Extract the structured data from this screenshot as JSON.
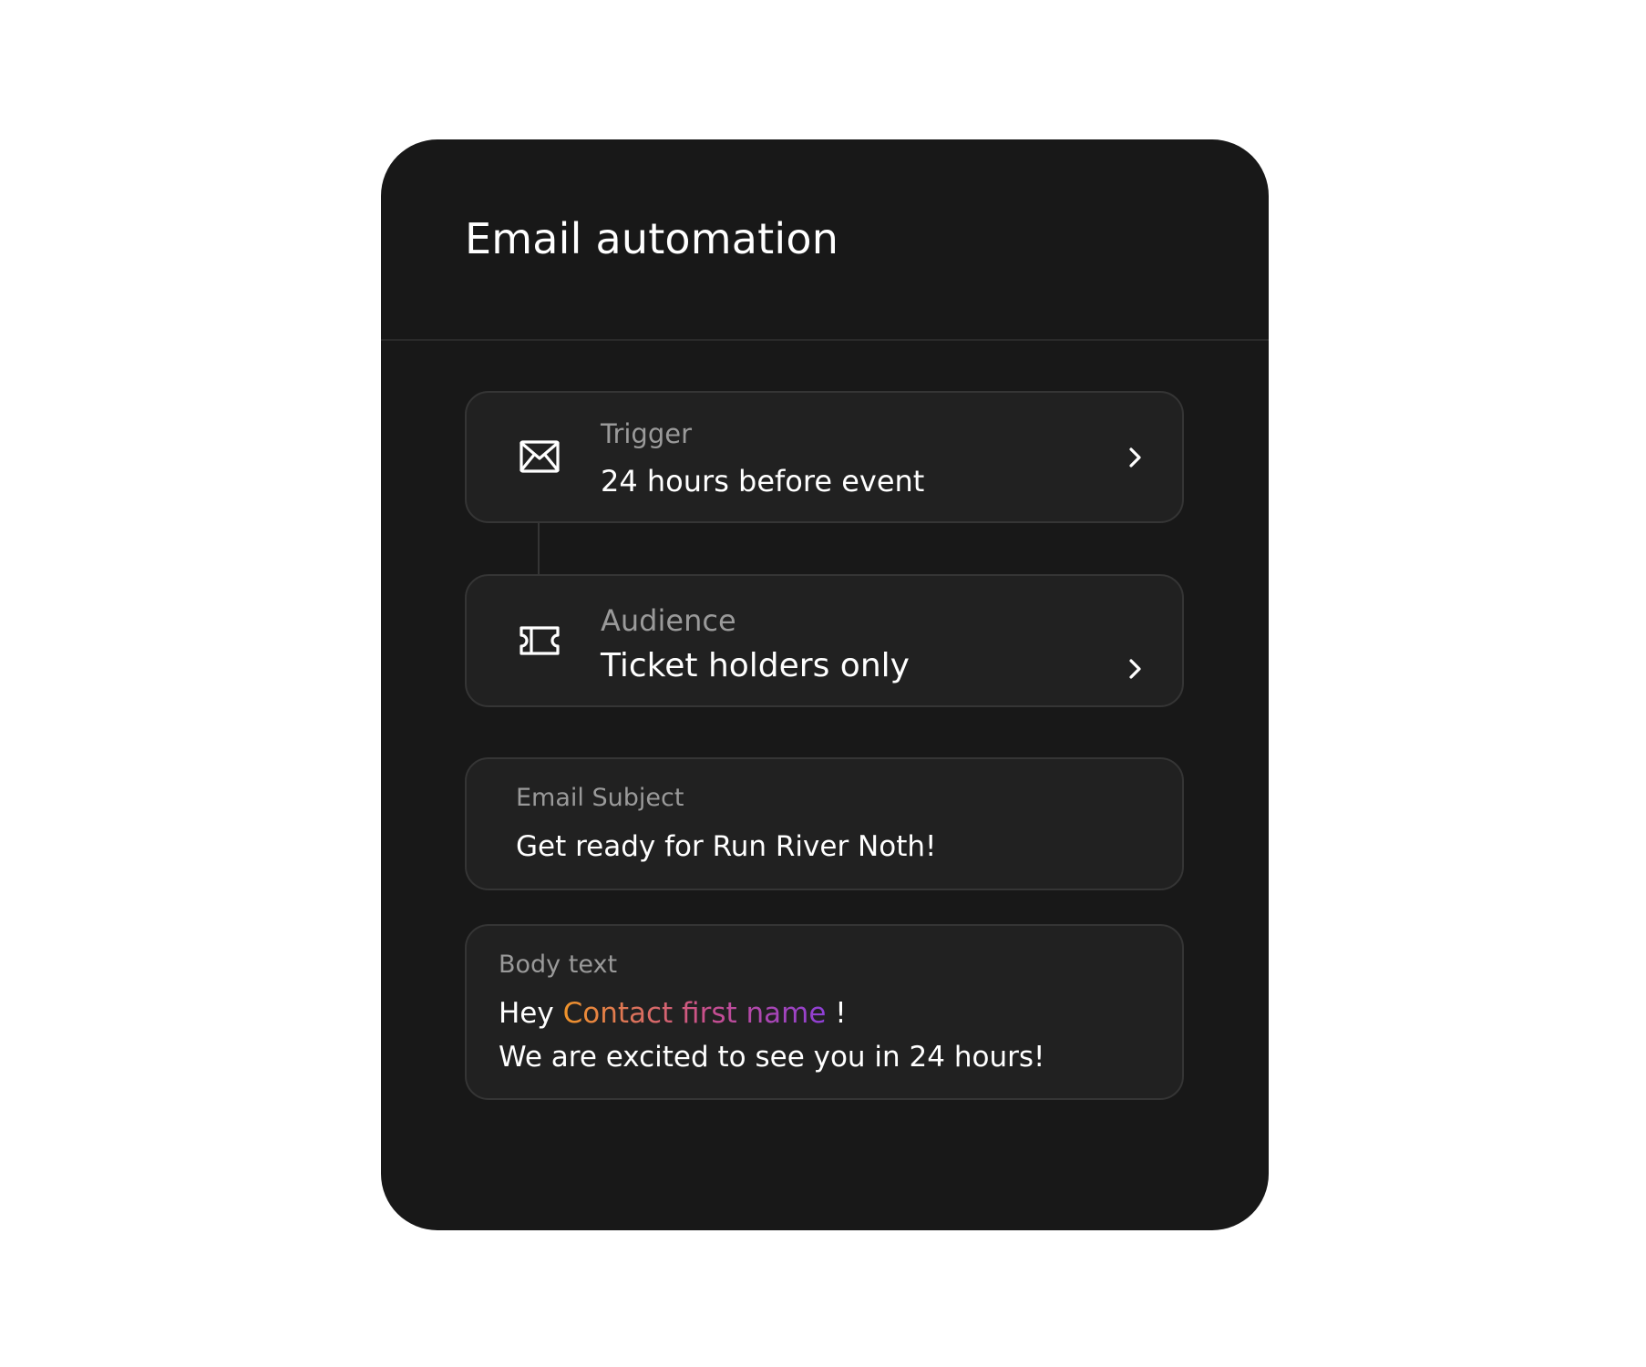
{
  "card": {
    "title": "Email automation"
  },
  "steps": [
    {
      "label": "Trigger",
      "value": "24 hours before event",
      "icon": "envelope-icon"
    },
    {
      "label": "Audience",
      "value": "Ticket holders only",
      "icon": "ticket-icon"
    }
  ],
  "subject": {
    "label": "Email Subject",
    "value": "Get ready for Run River Noth!"
  },
  "body": {
    "label": "Body text",
    "greeting": "Hey",
    "merge_tag": "Contact first name",
    "greeting_end": "!",
    "line2": "We are excited to see you in 24 hours!"
  },
  "colors": {
    "card_background": "#181818",
    "panel_background": "#212121",
    "panel_border": "#353535",
    "merge_tag_gradient": [
      "#f0942a",
      "#c94f8e",
      "#8d3fd6"
    ]
  }
}
